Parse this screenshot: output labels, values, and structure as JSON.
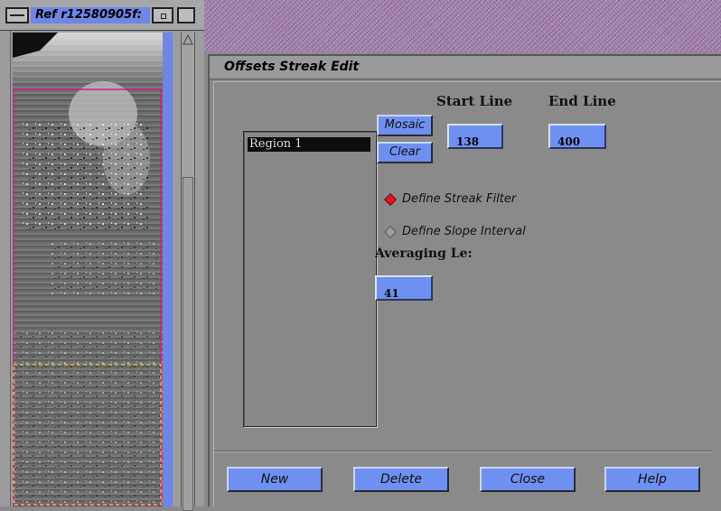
{
  "image_window": {
    "title": "Ref r12580905f:"
  },
  "dialog": {
    "title": "Offsets Streak Edit",
    "regions": [
      "Region 1"
    ],
    "mosaic_label": "Mosaic",
    "clear_label": "Clear",
    "start_line_label": "Start Line",
    "start_line_value": "138",
    "end_line_label": "End Line",
    "end_line_value": "400",
    "modes": [
      {
        "label": "Define Streak Filter",
        "selected": true
      },
      {
        "label": "Define Slope Interval",
        "selected": false
      }
    ],
    "averaging_label": "Averaging Le:",
    "averaging_value": "41",
    "buttons": {
      "new": "New",
      "delete": "Delete",
      "close": "Close",
      "help": "Help"
    }
  },
  "colors": {
    "button_blue": "#6e90f0",
    "selected_radio": "#e0141e",
    "region_outline": "#d0208a",
    "dashed_box": "#e8d040"
  }
}
